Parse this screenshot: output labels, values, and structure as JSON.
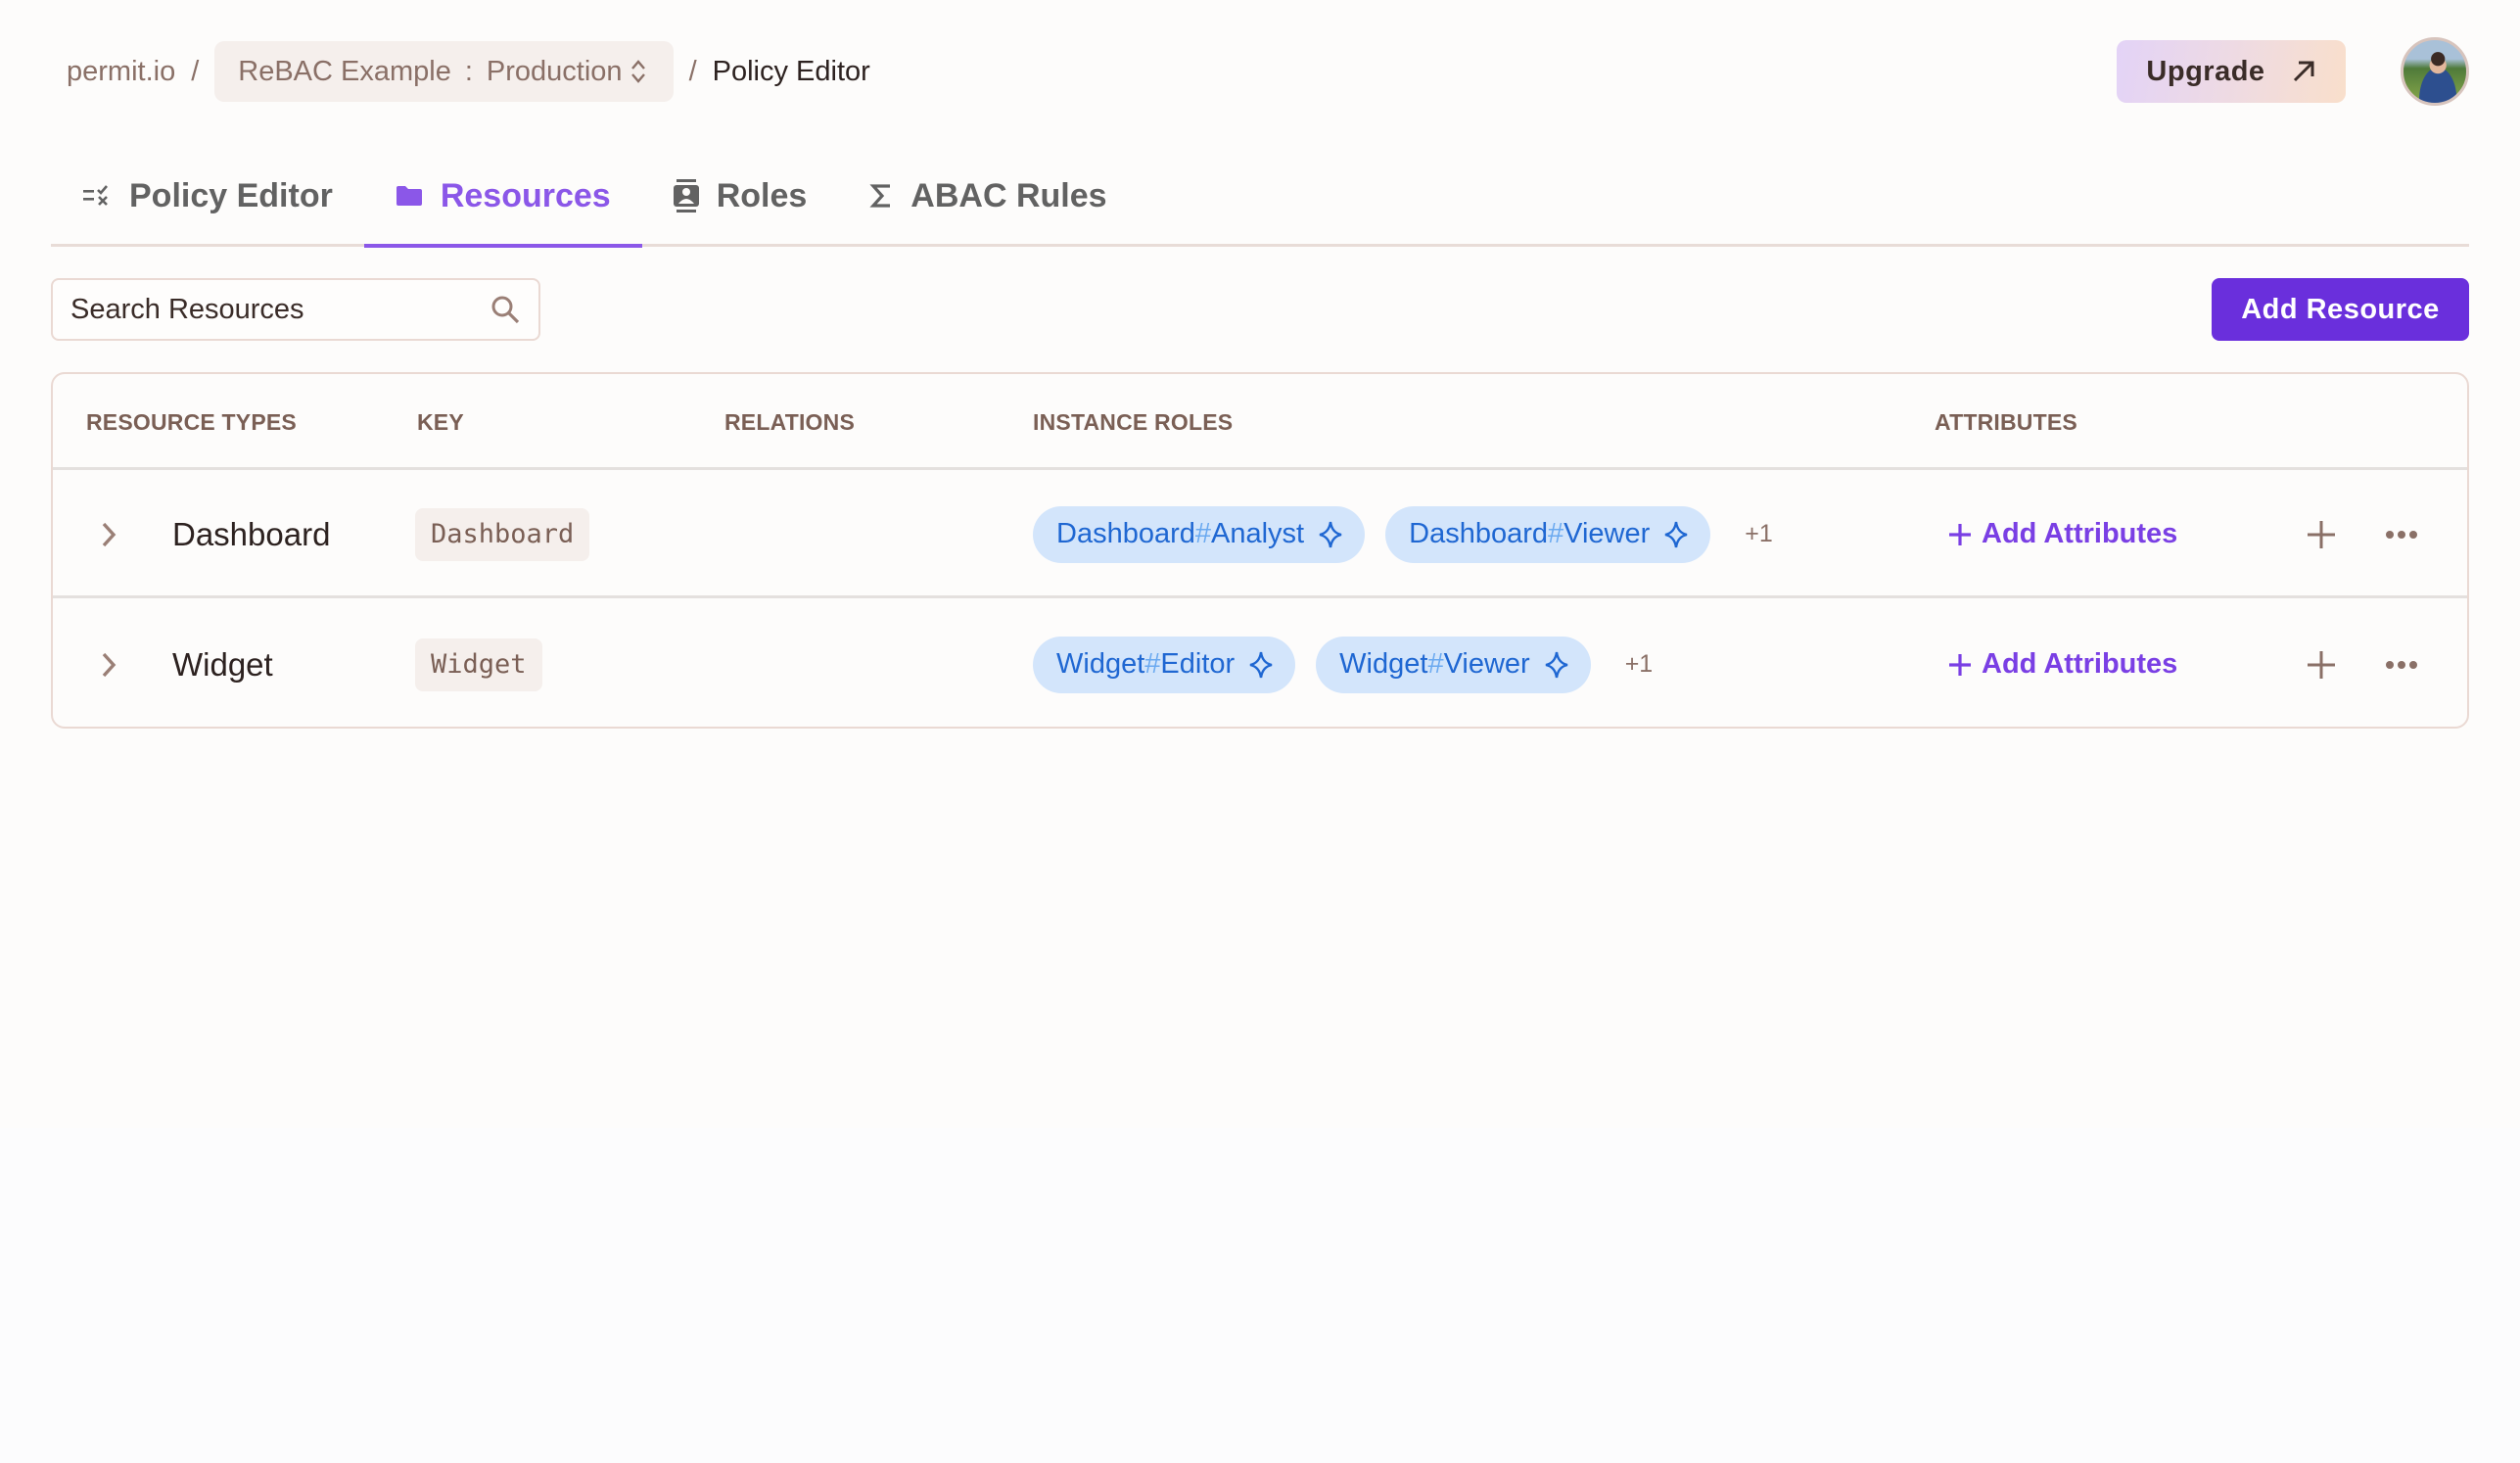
{
  "breadcrumb": {
    "root": "permit.io",
    "separator": "/",
    "project": "ReBAC Example",
    "colon": ":",
    "environment": "Production",
    "current": "Policy Editor"
  },
  "header": {
    "upgrade_label": "Upgrade",
    "avatar_alt": "User avatar"
  },
  "tabs": [
    {
      "label": "Policy Editor",
      "icon": "policy-list-icon",
      "active": false
    },
    {
      "label": "Resources",
      "icon": "folder-icon",
      "active": true
    },
    {
      "label": "Roles",
      "icon": "badge-icon",
      "active": false
    },
    {
      "label": "ABAC Rules",
      "icon": "sigma-icon",
      "active": false
    }
  ],
  "toolbar": {
    "search_placeholder": "Search Resources",
    "search_value": "",
    "add_resource_label": "Add Resource"
  },
  "table": {
    "columns": [
      "RESOURCE TYPES",
      "KEY",
      "RELATIONS",
      "INSTANCE ROLES",
      "ATTRIBUTES"
    ],
    "rows": [
      {
        "name": "Dashboard",
        "key": "Dashboard",
        "relations": "",
        "instance_roles": [
          {
            "resource": "Dashboard",
            "hash": "#",
            "role": "Analyst"
          },
          {
            "resource": "Dashboard",
            "hash": "#",
            "role": "Viewer"
          }
        ],
        "more_roles": "+1",
        "attributes_label": "Add Attributes"
      },
      {
        "name": "Widget",
        "key": "Widget",
        "relations": "",
        "instance_roles": [
          {
            "resource": "Widget",
            "hash": "#",
            "role": "Editor"
          },
          {
            "resource": "Widget",
            "hash": "#",
            "role": "Viewer"
          }
        ],
        "more_roles": "+1",
        "attributes_label": "Add Attributes"
      }
    ]
  },
  "colors": {
    "accent": "#6a2fdc",
    "active_tab": "#8b57e8",
    "role_pill_bg": "#d3e5fb",
    "role_pill_text": "#1f67d2",
    "muted_text": "#8a7067"
  }
}
